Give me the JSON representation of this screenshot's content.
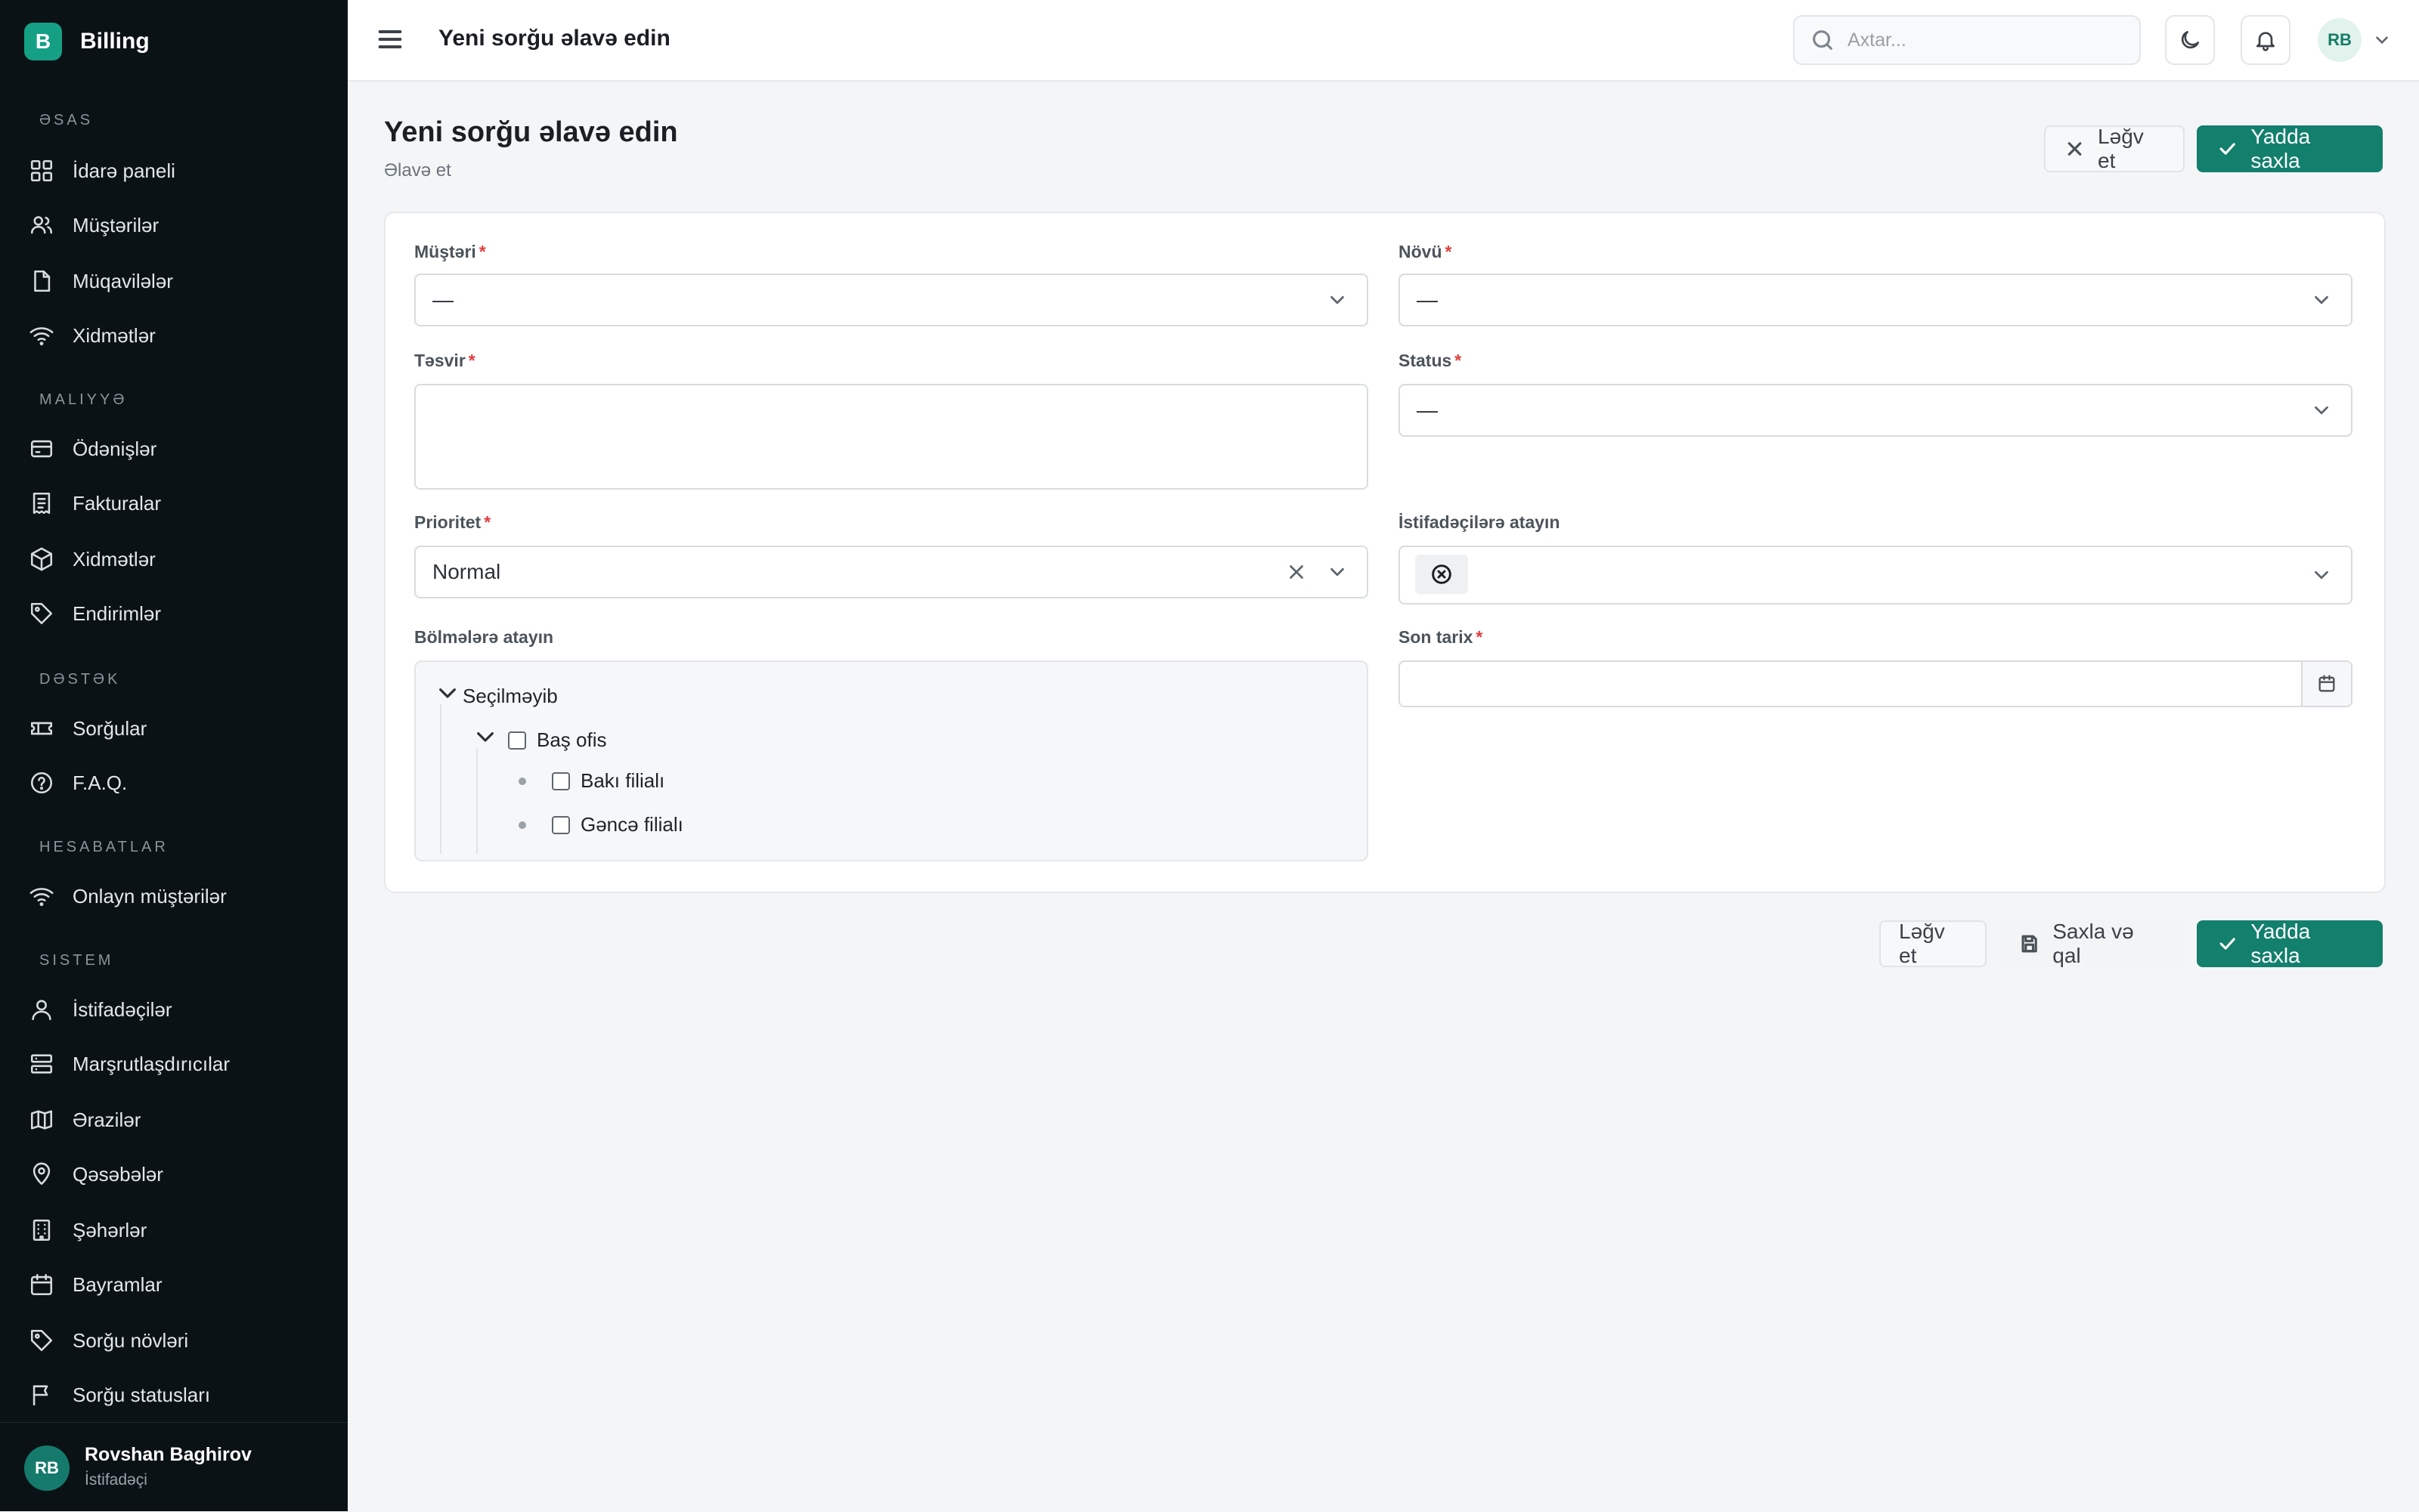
{
  "app": {
    "logo_letter": "B",
    "name": "Billing"
  },
  "sidebar": {
    "sections": [
      {
        "title": "Əsas",
        "items": [
          "İdarə paneli",
          "Müştərilər",
          "Müqavilələr",
          "Xidmətlər"
        ]
      },
      {
        "title": "Maliyyə",
        "items": [
          "Ödənişlər",
          "Fakturalar",
          "Xidmətlər",
          "Endirimlər"
        ]
      },
      {
        "title": "Dəstək",
        "items": [
          "Sorğular",
          "F.A.Q."
        ]
      },
      {
        "title": "Hesabatlar",
        "items": [
          "Onlayn müştərilər"
        ]
      },
      {
        "title": "Sistem",
        "items": [
          "İstifadəçilər",
          "Marşrutlaşdırıcılar",
          "Ərazilər",
          "Qəsəbələr",
          "Şəhərlər",
          "Bayramlar",
          "Sorğu növləri",
          "Sorğu statusları"
        ]
      }
    ],
    "user": {
      "initials": "RB",
      "name": "Rovshan Baghirov",
      "role": "İstifadəçi"
    }
  },
  "topbar": {
    "title": "Yeni sorğu əlavə edin",
    "search_placeholder": "Axtar...",
    "avatar_initials": "RB"
  },
  "page": {
    "title": "Yeni sorğu əlavə edin",
    "subtitle": "Əlavə et",
    "cancel_label": "Ləğv et",
    "save_label": "Yadda saxla"
  },
  "form": {
    "customer": {
      "label": "Müştəri",
      "value": "—"
    },
    "type": {
      "label": "Növü",
      "value": "—"
    },
    "description": {
      "label": "Təsvir",
      "value": ""
    },
    "status": {
      "label": "Status",
      "value": "—"
    },
    "priority": {
      "label": "Prioritet",
      "value": "Normal"
    },
    "assign_users": {
      "label": "İstifadəçilərə atayın"
    },
    "assign_departments": {
      "label": "Bölmələrə atayın",
      "root": "Seçilməyib",
      "node": "Baş ofis",
      "children": [
        "Bakı filialı",
        "Gəncə filialı"
      ]
    },
    "deadline": {
      "label": "Son tarix",
      "value": ""
    }
  },
  "footer_actions": {
    "cancel_label": "Ləğv et",
    "save_stay_label": "Saxla və qal",
    "save_label": "Yadda saxla"
  },
  "colors": {
    "primary": "#137f6d",
    "sidebar_bg": "#0b1216",
    "required": "#e23d3d"
  }
}
